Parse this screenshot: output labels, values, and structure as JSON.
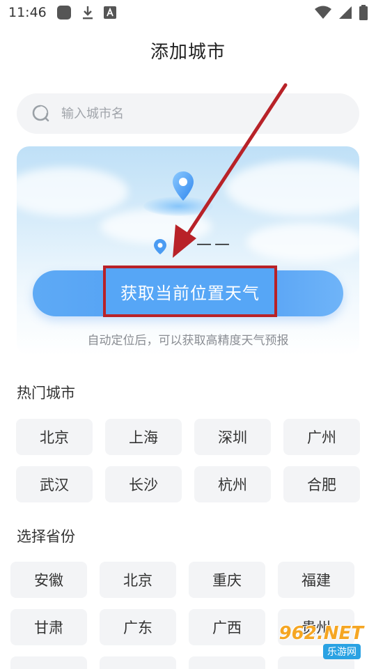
{
  "status_bar": {
    "time": "11:46",
    "icons": [
      "app-icon",
      "download-icon",
      "keyboard-a-icon",
      "wifi-icon",
      "signal-icon",
      "battery-icon"
    ]
  },
  "header": {
    "title": "添加城市"
  },
  "search": {
    "placeholder": "输入城市名",
    "value": ""
  },
  "location_card": {
    "current_city": "——",
    "button_label": "获取当前位置天气",
    "hint": "自动定位后，可以获取高精度天气预报"
  },
  "hot_cities": {
    "title": "热门城市",
    "items": [
      "北京",
      "上海",
      "深圳",
      "广州",
      "武汉",
      "长沙",
      "杭州",
      "合肥"
    ]
  },
  "provinces": {
    "title": "选择省份",
    "items": [
      "安徽",
      "北京",
      "重庆",
      "福建",
      "甘肃",
      "广东",
      "广西",
      "贵州"
    ]
  },
  "watermark": {
    "brand": "962.NET",
    "sub": "乐游网"
  },
  "colors": {
    "accent": "#4e9cf4",
    "annotation": "#b82228",
    "chip_bg": "#f3f4f6",
    "hint_text": "#8a8d93"
  }
}
